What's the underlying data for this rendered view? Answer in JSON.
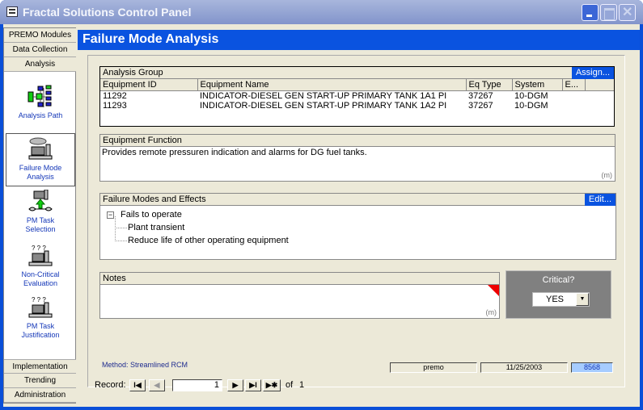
{
  "window": {
    "title": "Fractal Solutions Control Panel"
  },
  "sidebar": {
    "top_tabs": [
      "PREMO Modules",
      "Data Collection",
      "Analysis"
    ],
    "items": [
      {
        "label1": "Analysis Path",
        "label2": "",
        "icon": "tree-diagram-icon"
      },
      {
        "label1": "Failure Mode",
        "label2": "Analysis",
        "icon": "pump-failure-icon",
        "selected": true
      },
      {
        "label1": "PM Task",
        "label2": "Selection",
        "icon": "pump-wrench-icon"
      },
      {
        "label1": "Non-Critical",
        "label2": "Evaluation",
        "icon": "pump-question-icon"
      },
      {
        "label1": "PM Task",
        "label2": "Justification",
        "icon": "pump-question-icon"
      }
    ],
    "bottom_tabs": [
      "Implementation",
      "Trending",
      "Administration"
    ]
  },
  "header": {
    "title": "Failure Mode Analysis"
  },
  "analysis_group": {
    "title": "Analysis Group",
    "assign_label": "Assign...",
    "columns": [
      "Equipment ID",
      "Equipment Name",
      "Eq Type",
      "System",
      "E..."
    ],
    "rows": [
      [
        "11292",
        "INDICATOR-DIESEL GEN START-UP PRIMARY TANK 1A1 PI",
        "37267",
        "10-DGM",
        ""
      ],
      [
        "11293",
        "INDICATOR-DIESEL GEN START-UP PRIMARY TANK 1A2 PI",
        "37267",
        "10-DGM",
        ""
      ]
    ]
  },
  "equipment_function": {
    "title": "Equipment Function",
    "text": "Provides remote pressuren indication and alarms for DG fuel tanks.",
    "memo": "(m)"
  },
  "failure_modes": {
    "title": "Failure Modes and Effects",
    "edit_label": "Edit...",
    "mode": "Fails to operate",
    "effects": [
      "Plant transient",
      "Reduce life of other operating equipment"
    ]
  },
  "notes": {
    "title": "Notes",
    "text": "",
    "memo": "(m)"
  },
  "critical": {
    "label": "Critical?",
    "value": "YES"
  },
  "method": "Method:  Streamlined RCM",
  "status": {
    "user": "premo",
    "date": "11/25/2003",
    "id": "8568"
  },
  "record_nav": {
    "label": "Record:",
    "current": "1",
    "of_label": "of",
    "total": "1"
  }
}
